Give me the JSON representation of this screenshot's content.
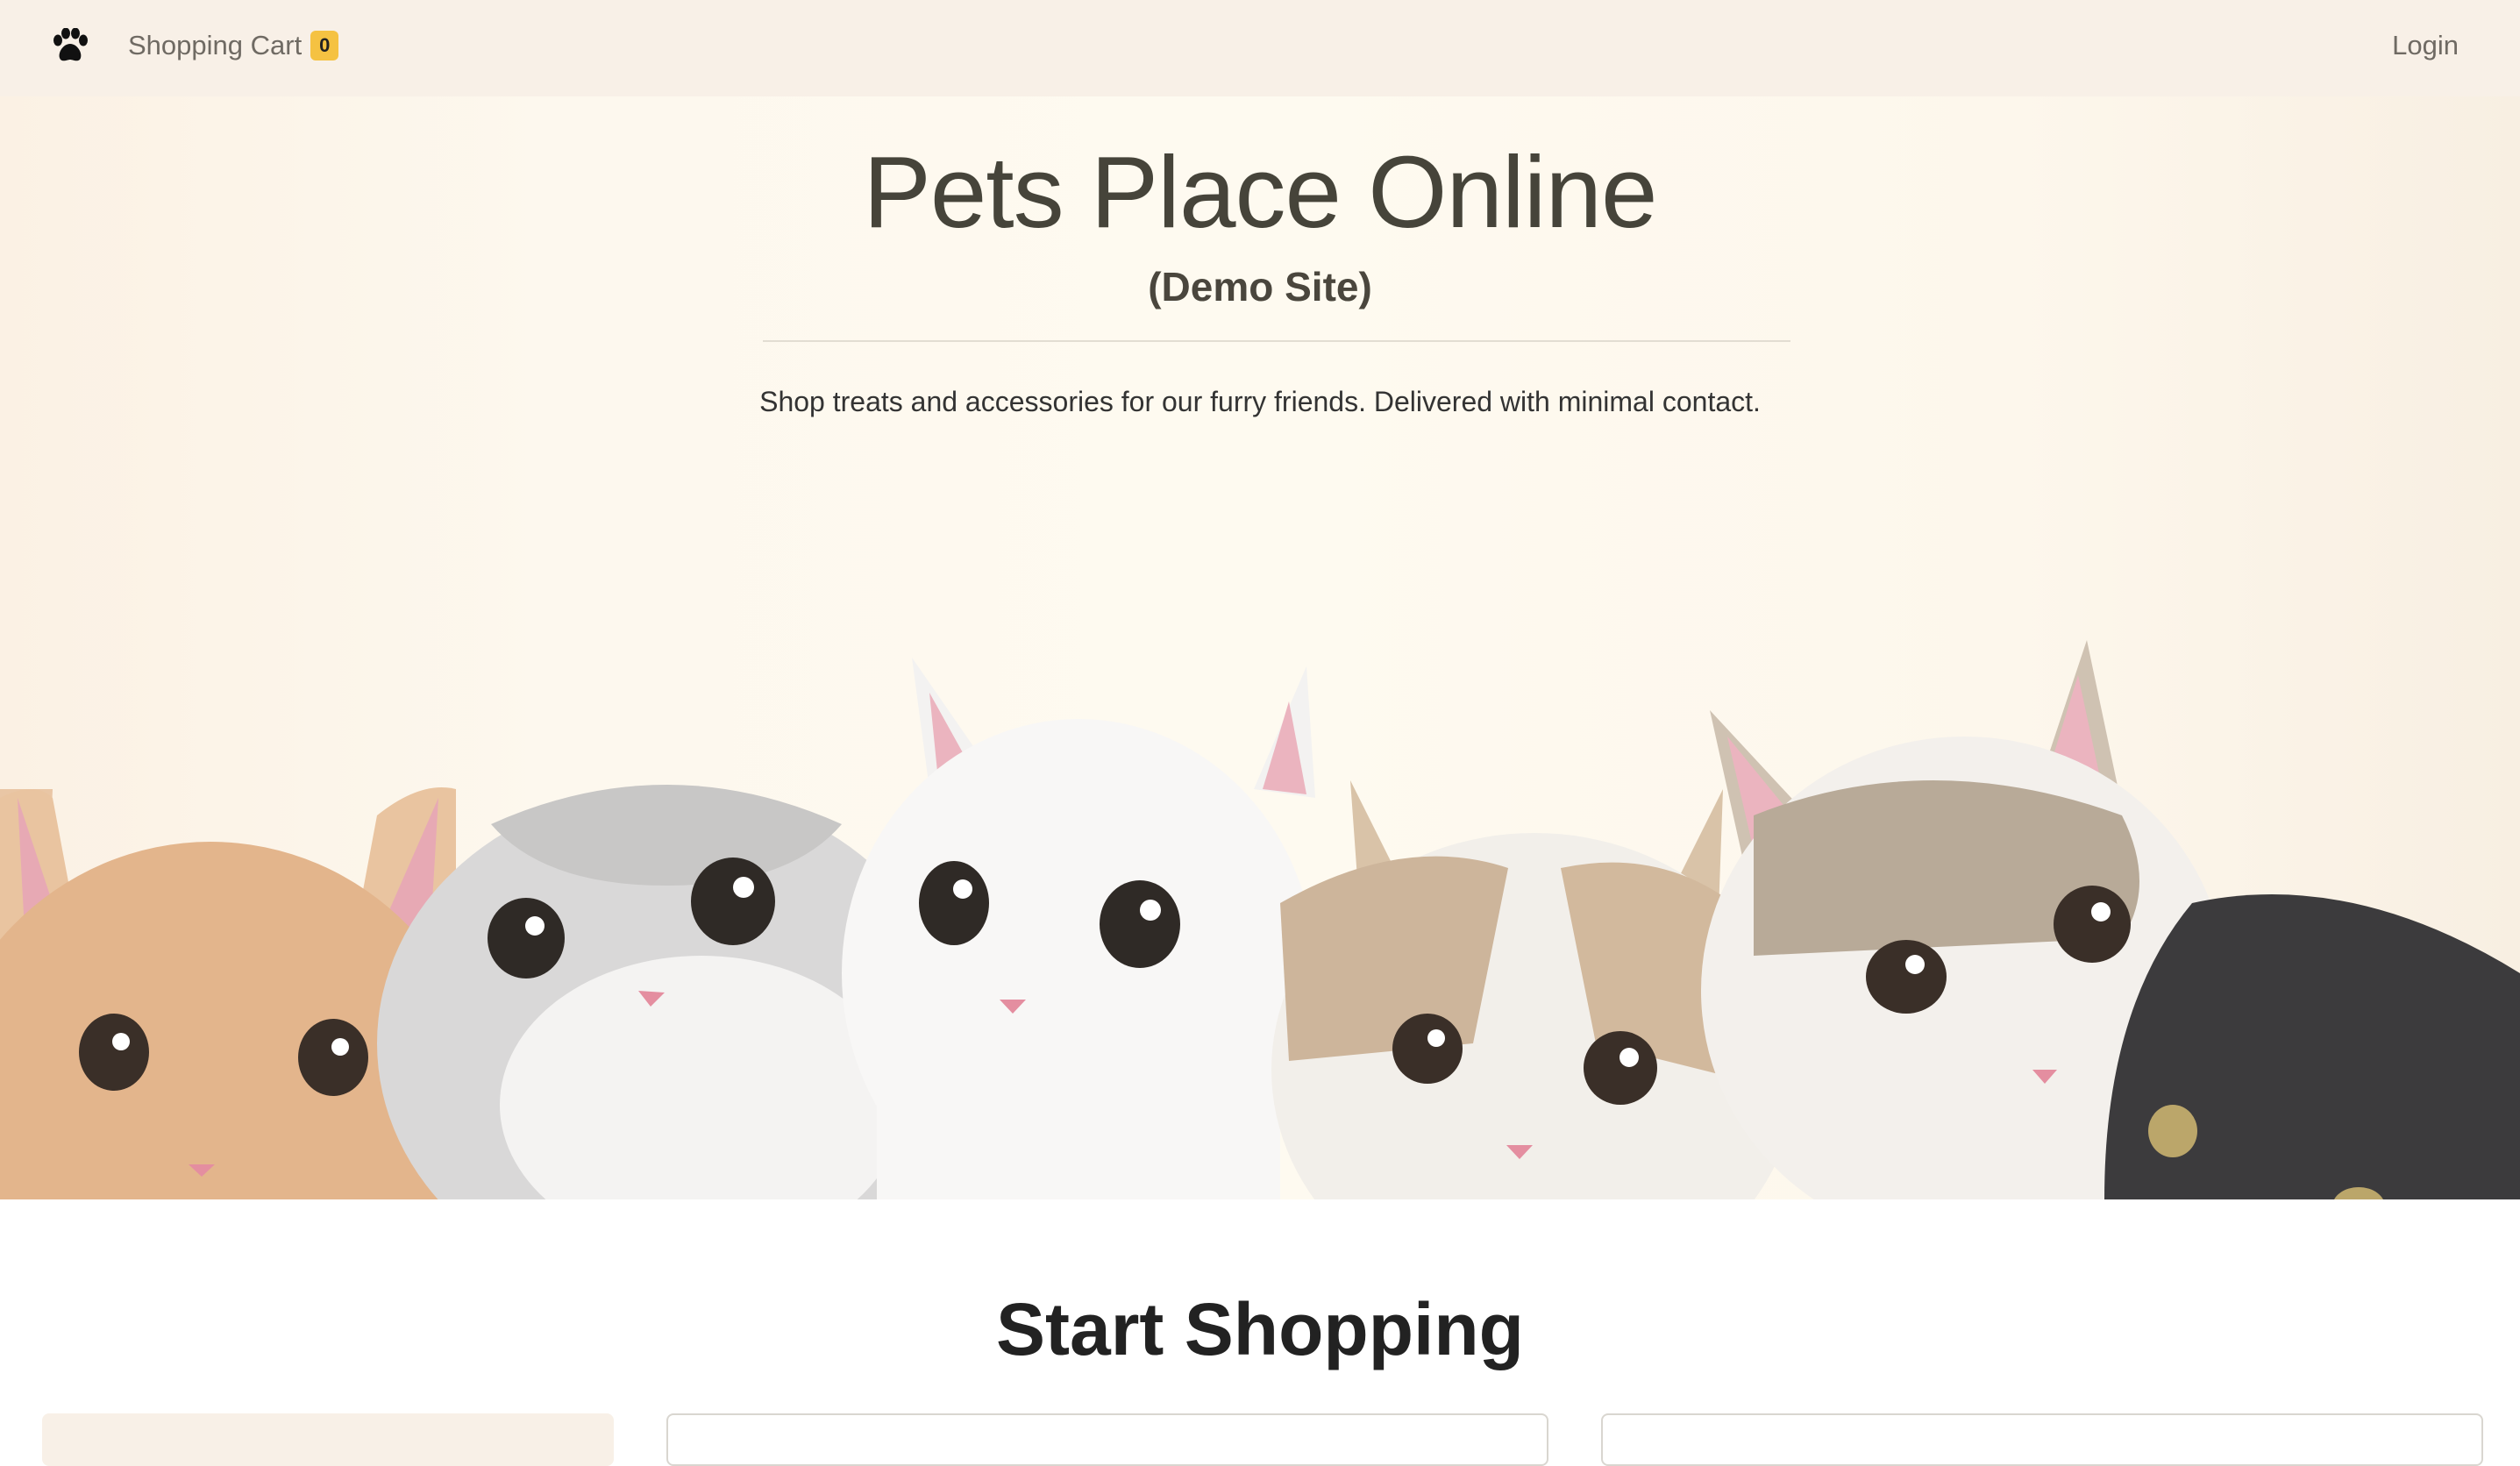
{
  "navbar": {
    "logo_icon": "paw-icon",
    "cart_label": "Shopping Cart",
    "cart_count": "0",
    "login_label": "Login",
    "background": "#f8f0e7",
    "badge_color": "#f5c242"
  },
  "hero": {
    "title": "Pets Place Online",
    "subtitle": "(Demo Site)",
    "tagline": "Shop treats and accessories for our furry friends. Delivered with minimal contact."
  },
  "shop": {
    "heading": "Start Shopping"
  }
}
